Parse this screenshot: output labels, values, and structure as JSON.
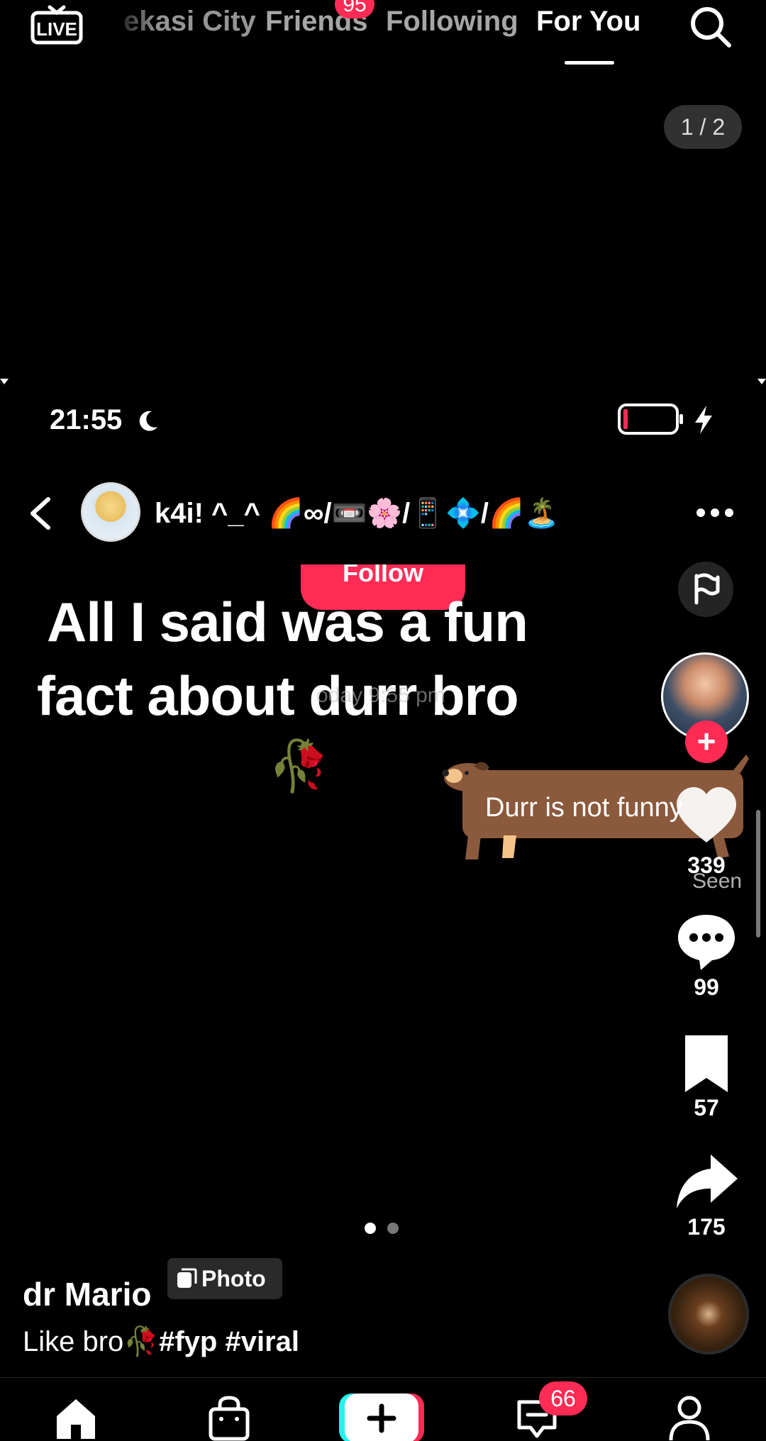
{
  "top_nav": {
    "live_label": "LIVE",
    "location_tab": "ekasi City",
    "friends_tab": "Friends",
    "friends_badge": "95",
    "following_tab": "Following",
    "for_you_tab": "For You"
  },
  "photo_counter": "1 / 2",
  "embedded_screenshot": {
    "status_time": "21:55",
    "chat_username": "k4i! ^_^ 🌈∞/📼🌸/📱💠/🌈🏝️",
    "follow_label": "Follow",
    "caption_line_1": "All I said was a fun",
    "caption_line_2": "fact about durr bro",
    "timestamp": "oday 9:55 pm",
    "rose_emoji": "🥀",
    "sticker_text": "Durr is not funny"
  },
  "right_rail": {
    "likes": "339",
    "seen_label": "Seen",
    "comments": "99",
    "saves": "57",
    "shares": "175"
  },
  "post": {
    "author": "dr Mario",
    "type_badge": "Photo",
    "caption_text": "Like bro🥀",
    "hashtags": "#fyp #viral"
  },
  "tabbar": {
    "inbox_badge": "66"
  },
  "colors": {
    "accent": "#fe2c55",
    "background": "#000000",
    "sticker_brown": "#8b5a3c"
  }
}
